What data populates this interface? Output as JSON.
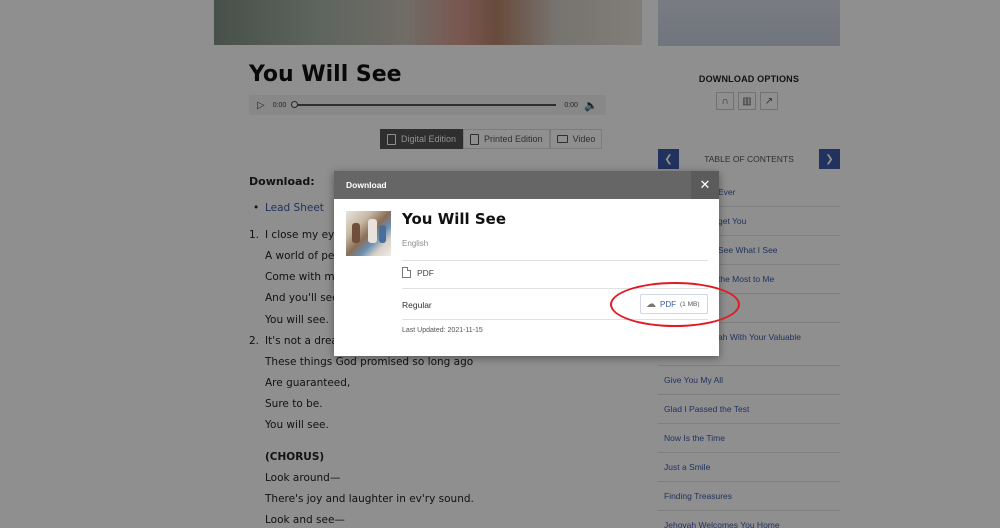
{
  "article": {
    "title": "You Will See",
    "audio": {
      "current_time": "0:00",
      "duration": "0:00"
    },
    "edition_tabs": [
      {
        "label": "Digital Edition",
        "active": true
      },
      {
        "label": "Printed Edition",
        "active": false
      },
      {
        "label": "Video",
        "active": false
      }
    ],
    "download_label": "Download:",
    "lead_sheet_link": "Lead Sheet",
    "lyrics": {
      "v1_num": "1.",
      "v1": [
        "I close my eye",
        "A world of pea",
        "Come with me",
        "And you'll see.",
        "You will see."
      ],
      "v2_num": "2.",
      "v2": [
        "It's not a dream",
        "These things God promised so long ago",
        "Are guaranteed,",
        "Sure to be.",
        "You will see."
      ],
      "chorus_label": "(CHORUS)",
      "chorus": [
        "Look around—",
        "There's joy and laughter in ev'ry sound.",
        "Look and see—"
      ]
    }
  },
  "sidebar": {
    "download_options_title": "DOWNLOAD OPTIONS",
    "toc_label": "TABLE OF CONTENTS",
    "toc_items": [
      "Ever",
      "get You",
      "See What I See",
      "the Most to Me",
      "",
      "ah With Your Valuable",
      "Give You My All",
      "Glad I Passed the Test",
      "Now Is the Time",
      "Just a Smile",
      "Finding Treasures",
      "Jehovah Welcomes You Home"
    ]
  },
  "modal": {
    "header": "Download",
    "close_symbol": "✕",
    "title": "You Will See",
    "language": "English",
    "format": "PDF",
    "variant": "Regular",
    "button_label": "PDF",
    "button_size": "(1 MB)",
    "last_updated": "Last Updated: 2021-11-15"
  },
  "annotation": {
    "color": "#e01b24"
  },
  "colors": {
    "accent": "#3d5aa8",
    "overlay": "rgba(0,0,0,0.44)"
  }
}
